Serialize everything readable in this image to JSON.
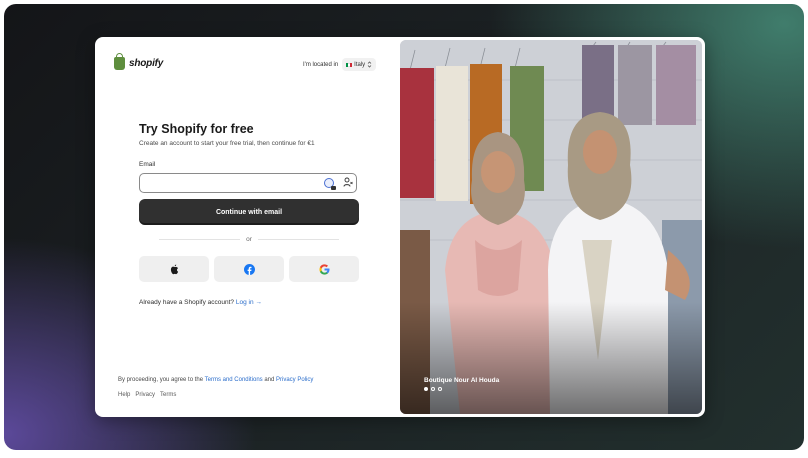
{
  "brand": {
    "name": "shopify",
    "logo_color": "#5e8e3e"
  },
  "locale": {
    "label": "I'm located in",
    "country": "Italy",
    "flag_colors": [
      "#009246",
      "#ffffff",
      "#ce2b37"
    ]
  },
  "signup": {
    "title": "Try Shopify for free",
    "subtitle": "Create an account to start your free trial, then continue for €1",
    "email_label": "Email",
    "email_value": "",
    "email_placeholder": "",
    "continue_label": "Continue with email",
    "divider_label": "or",
    "social": [
      {
        "icon": "apple-icon"
      },
      {
        "icon": "facebook-icon",
        "color": "#1877f2"
      },
      {
        "icon": "google-icon"
      }
    ],
    "login_prompt": "Already have a Shopify account?",
    "login_link": "Log in →"
  },
  "legal": {
    "prefix": "By proceeding, you agree to the",
    "terms_link": "Terms and Conditions",
    "and": "and",
    "privacy_link": "Privacy Policy"
  },
  "footer_links": [
    "Help",
    "Privacy",
    "Terms"
  ],
  "hero": {
    "caption": "Boutique Nour Al Houda",
    "slide_count": 3,
    "active_slide": 1
  },
  "colors": {
    "primary_button": "#303030",
    "link": "#2c6ecb"
  }
}
